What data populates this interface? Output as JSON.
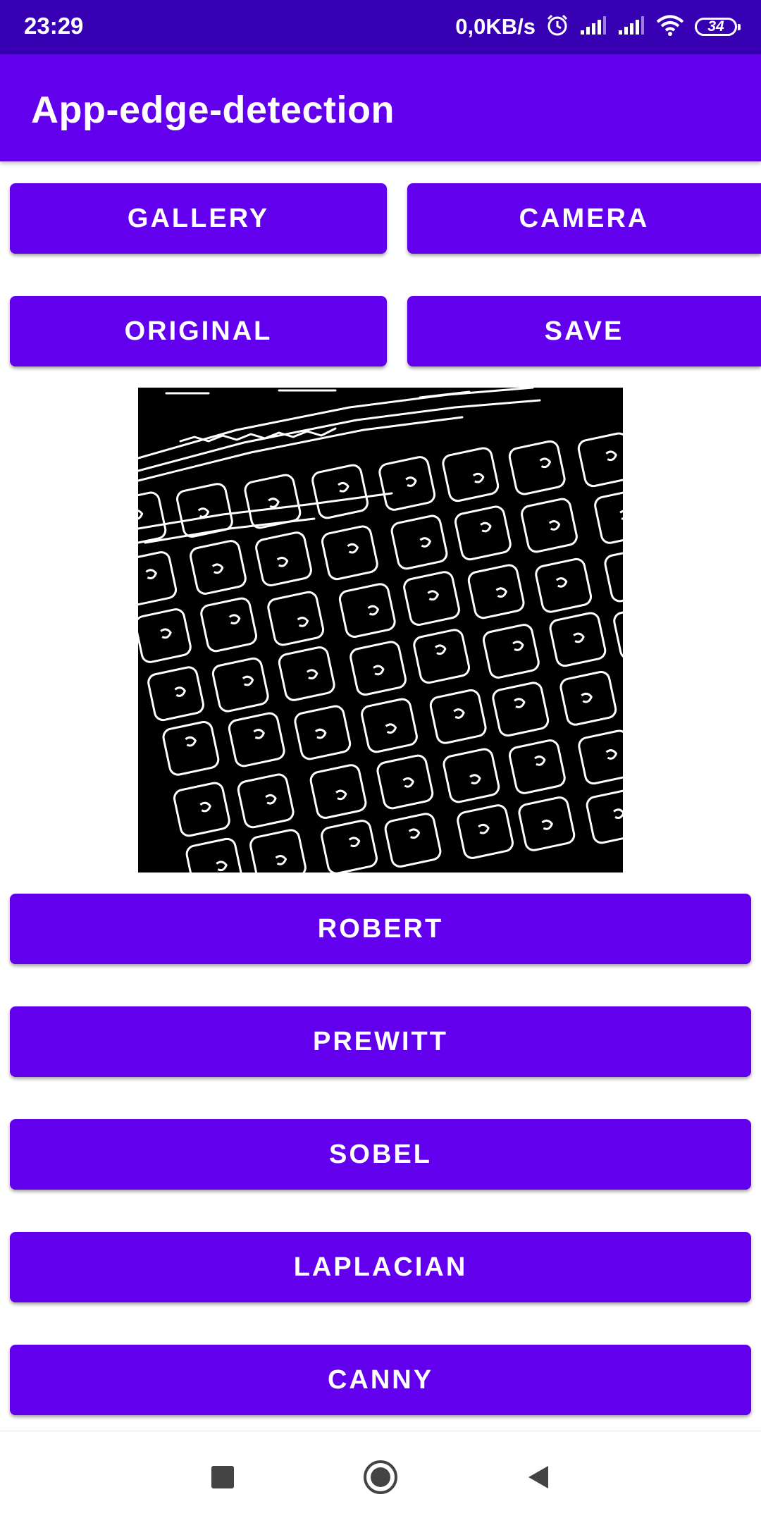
{
  "status_bar": {
    "time": "23:29",
    "net_speed": "0,0KB/s",
    "battery_level": "34",
    "icons": [
      "alarm-icon",
      "signal-icon",
      "signal-icon",
      "wifi-icon",
      "battery-icon"
    ]
  },
  "app_bar": {
    "title": "App-edge-detection"
  },
  "top_buttons": {
    "gallery": "GALLERY",
    "camera": "CAMERA",
    "original": "ORIGINAL",
    "save": "SAVE"
  },
  "filter_buttons": [
    "ROBERT",
    "PREWITT",
    "SOBEL",
    "LAPLACIAN",
    "CANNY"
  ],
  "nav_bar": {
    "icons": [
      "recents-square-icon",
      "home-circle-icon",
      "back-triangle-icon"
    ]
  },
  "colors": {
    "primary": "#6200ee",
    "primary_dark": "#3700b3",
    "on_primary": "#ffffff"
  }
}
